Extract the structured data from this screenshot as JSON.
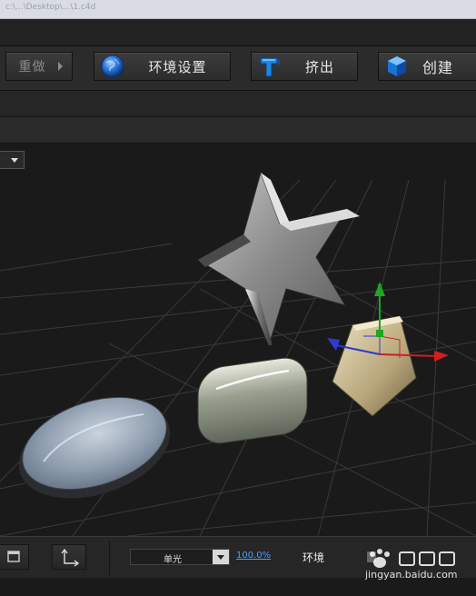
{
  "titlebar": {
    "path": "c:\\...\\Desktop\\...\\1.c4d"
  },
  "toolbar": {
    "redo_label": "重做",
    "environment_label": "环境设置",
    "extrude_label": "挤出",
    "create_label": "创建"
  },
  "viewport": {
    "axis_y_label": "Y",
    "objects": [
      "star",
      "pentagon",
      "rounded-cylinder",
      "disc"
    ]
  },
  "bottom": {
    "light_select_value": "单光",
    "percent": "100.0%",
    "environment_label": "环境"
  },
  "watermark": {
    "text": "jingyan.baidu.com",
    "logo": "Baidu 经验"
  },
  "colors": {
    "axis_x": "#d01f1f",
    "axis_y": "#1fa51f",
    "axis_z": "#2b3bd4",
    "link_blue": "#3fa0ff"
  }
}
